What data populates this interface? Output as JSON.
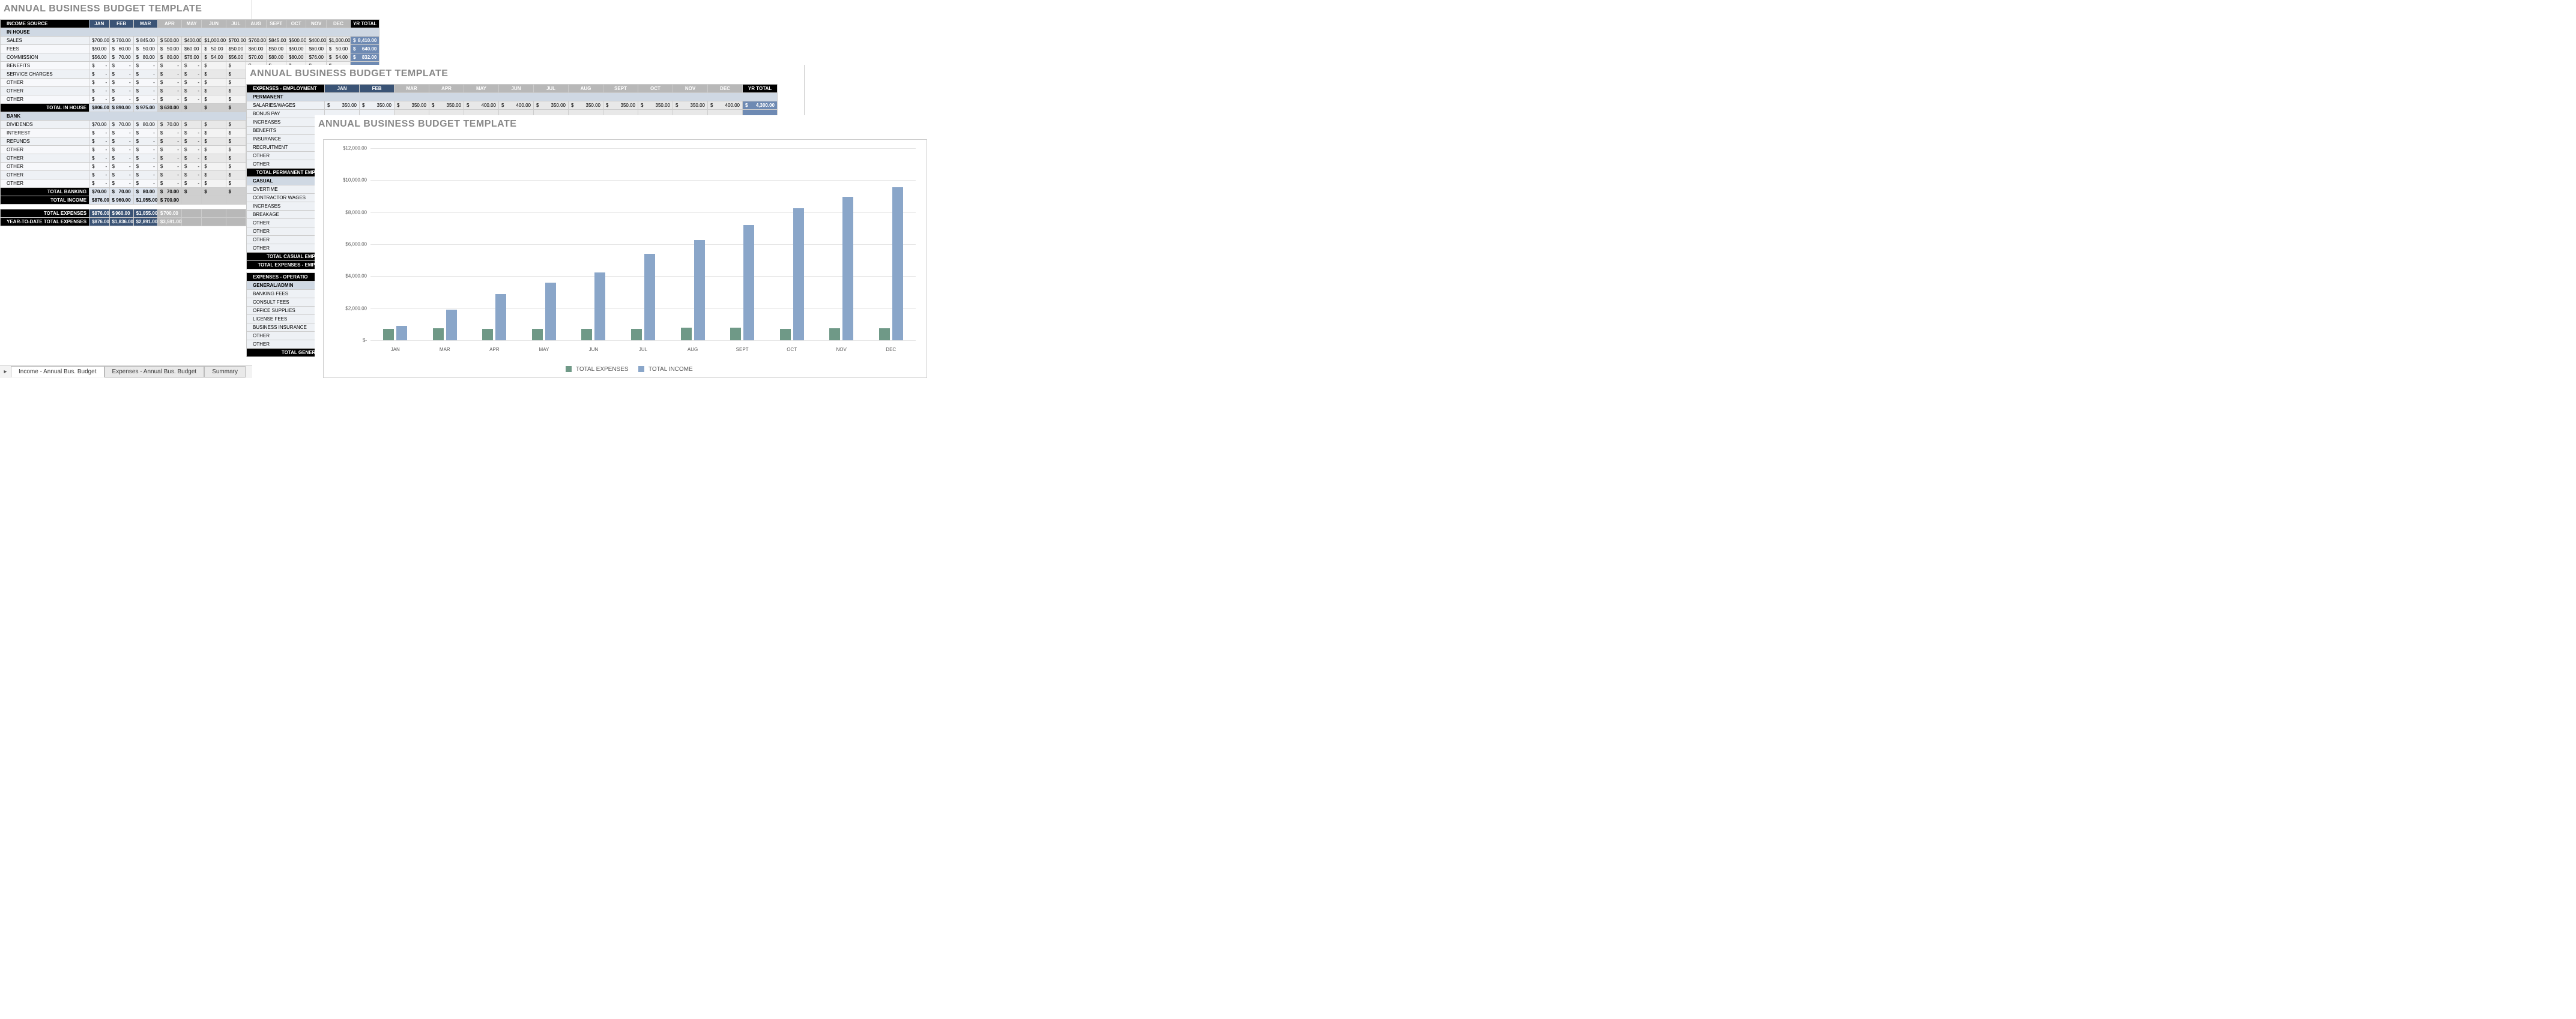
{
  "title": "ANNUAL BUSINESS BUDGET TEMPLATE",
  "months": [
    "JAN",
    "FEB",
    "MAR",
    "APR",
    "MAY",
    "JUN",
    "JUL",
    "AUG",
    "SEPT",
    "OCT",
    "NOV",
    "DEC"
  ],
  "yr_total_label": "YR TOTAL",
  "income": {
    "header": "INCOME SOURCE",
    "groups": [
      {
        "name": "IN HOUSE",
        "rows": [
          {
            "label": "SALES",
            "vals": [
              "700.00",
              "760.00",
              "845.00",
              "500.00",
              "400.00",
              "1,000.00",
              "700.00",
              "760.00",
              "845.00",
              "500.00",
              "400.00",
              "1,000.00"
            ],
            "yr": "8,410.00"
          },
          {
            "label": "FEES",
            "vals": [
              "50.00",
              "60.00",
              "50.00",
              "50.00",
              "60.00",
              "50.00",
              "50.00",
              "60.00",
              "50.00",
              "50.00",
              "60.00",
              "50.00"
            ],
            "yr": "640.00"
          },
          {
            "label": "COMMISSION",
            "vals": [
              "56.00",
              "70.00",
              "80.00",
              "80.00",
              "76.00",
              "54.00",
              "56.00",
              "70.00",
              "80.00",
              "80.00",
              "76.00",
              "54.00"
            ],
            "yr": "832.00"
          },
          {
            "label": "BENEFITS",
            "vals": [
              "-",
              "-",
              "-",
              "-",
              "-",
              "",
              "",
              "",
              "",
              "",
              "",
              ""
            ],
            "yr": ""
          },
          {
            "label": "SERVICE CHARGES",
            "vals": [
              "-",
              "-",
              "-",
              "-",
              "-",
              "",
              "",
              "",
              "",
              "",
              "",
              ""
            ],
            "yr": ""
          },
          {
            "label": "OTHER",
            "vals": [
              "-",
              "-",
              "-",
              "-",
              "-",
              "",
              "",
              "",
              "",
              "",
              "",
              ""
            ],
            "yr": ""
          },
          {
            "label": "OTHER",
            "vals": [
              "-",
              "-",
              "-",
              "-",
              "-",
              "",
              "",
              "",
              "",
              "",
              "",
              ""
            ],
            "yr": ""
          },
          {
            "label": "OTHER",
            "vals": [
              "-",
              "-",
              "-",
              "-",
              "-",
              "",
              "",
              "",
              "",
              "",
              "",
              ""
            ],
            "yr": ""
          }
        ],
        "total_label": "TOTAL IN HOUSE",
        "total_vals": [
          "806.00",
          "890.00",
          "975.00",
          "630.00",
          "",
          "",
          "",
          "",
          "",
          "",
          "",
          ""
        ]
      },
      {
        "name": "BANK",
        "rows": [
          {
            "label": "DIVIDENDS",
            "vals": [
              "70.00",
              "70.00",
              "80.00",
              "70.00",
              "",
              "",
              "",
              "",
              "",
              "",
              "",
              ""
            ],
            "yr": ""
          },
          {
            "label": "INTEREST",
            "vals": [
              "-",
              "-",
              "-",
              "-",
              "-",
              "",
              "",
              "",
              "",
              "",
              "",
              ""
            ],
            "yr": ""
          },
          {
            "label": "REFUNDS",
            "vals": [
              "-",
              "-",
              "-",
              "-",
              "-",
              "",
              "",
              "",
              "",
              "",
              "",
              ""
            ],
            "yr": ""
          },
          {
            "label": "OTHER",
            "vals": [
              "-",
              "-",
              "-",
              "-",
              "-",
              "",
              "",
              "",
              "",
              "",
              "",
              ""
            ],
            "yr": ""
          },
          {
            "label": "OTHER",
            "vals": [
              "-",
              "-",
              "-",
              "-",
              "-",
              "",
              "",
              "",
              "",
              "",
              "",
              ""
            ],
            "yr": ""
          },
          {
            "label": "OTHER",
            "vals": [
              "-",
              "-",
              "-",
              "-",
              "-",
              "",
              "",
              "",
              "",
              "",
              "",
              ""
            ],
            "yr": ""
          },
          {
            "label": "OTHER",
            "vals": [
              "-",
              "-",
              "-",
              "-",
              "-",
              "",
              "",
              "",
              "",
              "",
              "",
              ""
            ],
            "yr": ""
          },
          {
            "label": "OTHER",
            "vals": [
              "-",
              "-",
              "-",
              "-",
              "-",
              "",
              "",
              "",
              "",
              "",
              "",
              ""
            ],
            "yr": ""
          }
        ],
        "total_label": "TOTAL BANKING",
        "total_vals": [
          "70.00",
          "70.00",
          "80.00",
          "70.00",
          "",
          "",
          "",
          "",
          "",
          "",
          "",
          ""
        ]
      }
    ],
    "grand": [
      {
        "label": "TOTAL INCOME",
        "vals": [
          "876.00",
          "960.00",
          "1,055.00",
          "700.00",
          "",
          "",
          "",
          "",
          "",
          "",
          "",
          ""
        ]
      },
      {
        "label": "TOTAL EXPENSES",
        "vals": [
          "876.00",
          "960.00",
          "1,055.00",
          "700.00",
          "",
          "",
          "",
          "",
          "",
          "",
          "",
          ""
        ]
      },
      {
        "label": "YEAR-TO-DATE TOTAL EXPENSES",
        "vals": [
          "876.00",
          "1,836.00",
          "2,891.00",
          "3,591.00",
          "",
          "",
          "",
          "",
          "",
          "",
          "",
          ""
        ]
      }
    ]
  },
  "expenses": {
    "header": "EXPENSES - EMPLOYMENT",
    "perm_label": "PERMANENT",
    "perm_rows": [
      {
        "label": "SALARIES/WAGES",
        "vals": [
          "350.00",
          "350.00",
          "350.00",
          "350.00",
          "400.00",
          "400.00",
          "350.00",
          "350.00",
          "350.00",
          "350.00",
          "350.00",
          "400.00"
        ],
        "yr": "4,300.00"
      },
      {
        "label": "BONUS PAY"
      },
      {
        "label": "INCREASES"
      },
      {
        "label": "BENEFITS"
      },
      {
        "label": "INSURANCE"
      },
      {
        "label": "RECRUITMENT"
      },
      {
        "label": "OTHER"
      },
      {
        "label": "OTHER"
      }
    ],
    "perm_total_label": "TOTAL PERMANENT EMPLO",
    "casual_label": "CASUAL",
    "casual_rows": [
      {
        "label": "OVERTIME"
      },
      {
        "label": "CONTRACTOR WAGES"
      },
      {
        "label": "INCREASES"
      },
      {
        "label": "BREAKAGE"
      },
      {
        "label": "OTHER"
      },
      {
        "label": "OTHER"
      },
      {
        "label": "OTHER"
      },
      {
        "label": "OTHER"
      }
    ],
    "casual_total_label": "TOTAL CASUAL EMPLO",
    "emp_total_label": "TOTAL EXPENSES - EMPLO",
    "ops_header": "EXPENSES - OPERATIO",
    "ga_label": "GENERAL/ADMIN",
    "ga_rows": [
      {
        "label": "BANKING FEES"
      },
      {
        "label": "CONSULT FEES"
      },
      {
        "label": "OFFICE SUPPLIES"
      },
      {
        "label": "LICENSE FEES"
      },
      {
        "label": "BUSINESS INSURANCE"
      },
      {
        "label": "OTHER"
      },
      {
        "label": "OTHER"
      }
    ],
    "ga_total_label": "TOTAL GENERAL"
  },
  "tabs": {
    "t1": "Income - Annual Bus. Budget",
    "t2": "Expenses - Annual Bus. Budget",
    "t3": "Summary"
  },
  "chart_data": {
    "type": "bar",
    "categories": [
      "JAN",
      "MAR",
      "APR",
      "MAY",
      "JUN",
      "JUL",
      "AUG",
      "SEPT",
      "OCT",
      "NOV",
      "DEC"
    ],
    "series": [
      {
        "name": "TOTAL EXPENSES",
        "values": [
          700,
          750,
          700,
          720,
          730,
          730,
          780,
          800,
          720,
          740,
          760
        ]
      },
      {
        "name": "TOTAL INCOME",
        "values": [
          900,
          1900,
          2900,
          3600,
          4250,
          5400,
          6250,
          7200,
          8250,
          8950,
          9550
        ]
      }
    ],
    "title": "",
    "xlabel": "",
    "ylabel": "",
    "ylim": [
      0,
      12000
    ],
    "yticks": [
      "$-",
      "$2,000.00",
      "$4,000.00",
      "$6,000.00",
      "$8,000.00",
      "$10,000.00",
      "$12,000.00"
    ],
    "legend_labels": [
      "TOTAL EXPENSES",
      "TOTAL INCOME"
    ],
    "colors": {
      "expenses": "#6f9987",
      "income": "#8aa6c9"
    }
  }
}
